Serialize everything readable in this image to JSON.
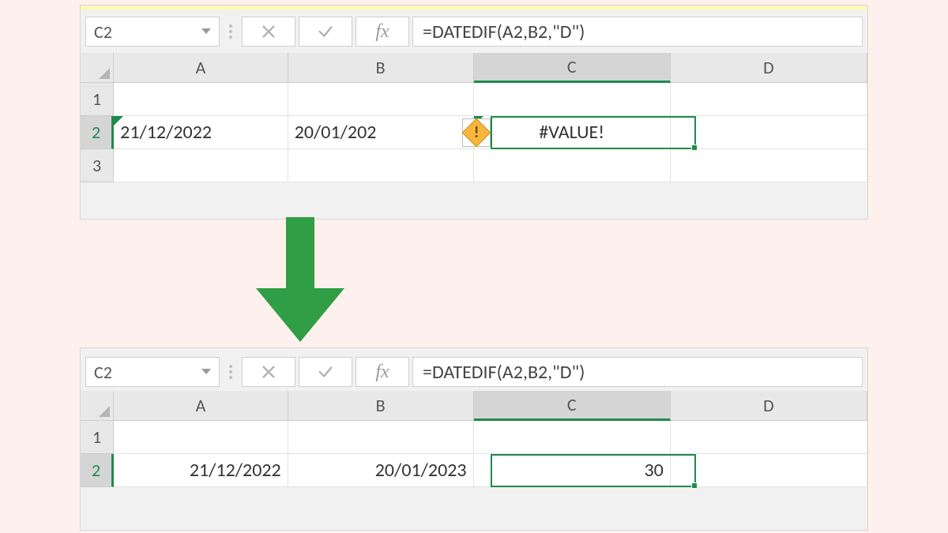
{
  "top": {
    "namebox": "C2",
    "formula": "=DATEDIF(A2,B2,\"D\")",
    "columns": [
      "A",
      "B",
      "C",
      "D"
    ],
    "rows": [
      "1",
      "2",
      "3"
    ],
    "cells": {
      "A2": "21/12/2022",
      "B2": "20/01/202",
      "C2": "#VALUE!"
    },
    "selected_col": "C",
    "selected_row": "2"
  },
  "bottom": {
    "namebox": "C2",
    "formula": "=DATEDIF(A2,B2,\"D\")",
    "columns": [
      "A",
      "B",
      "C",
      "D"
    ],
    "rows": [
      "1",
      "2"
    ],
    "cells": {
      "A2": "21/12/2022",
      "B2": "20/01/2023",
      "C2": "30"
    },
    "selected_col": "C",
    "selected_row": "2"
  },
  "icons": {
    "fx": "fx",
    "error_bang": "!"
  }
}
